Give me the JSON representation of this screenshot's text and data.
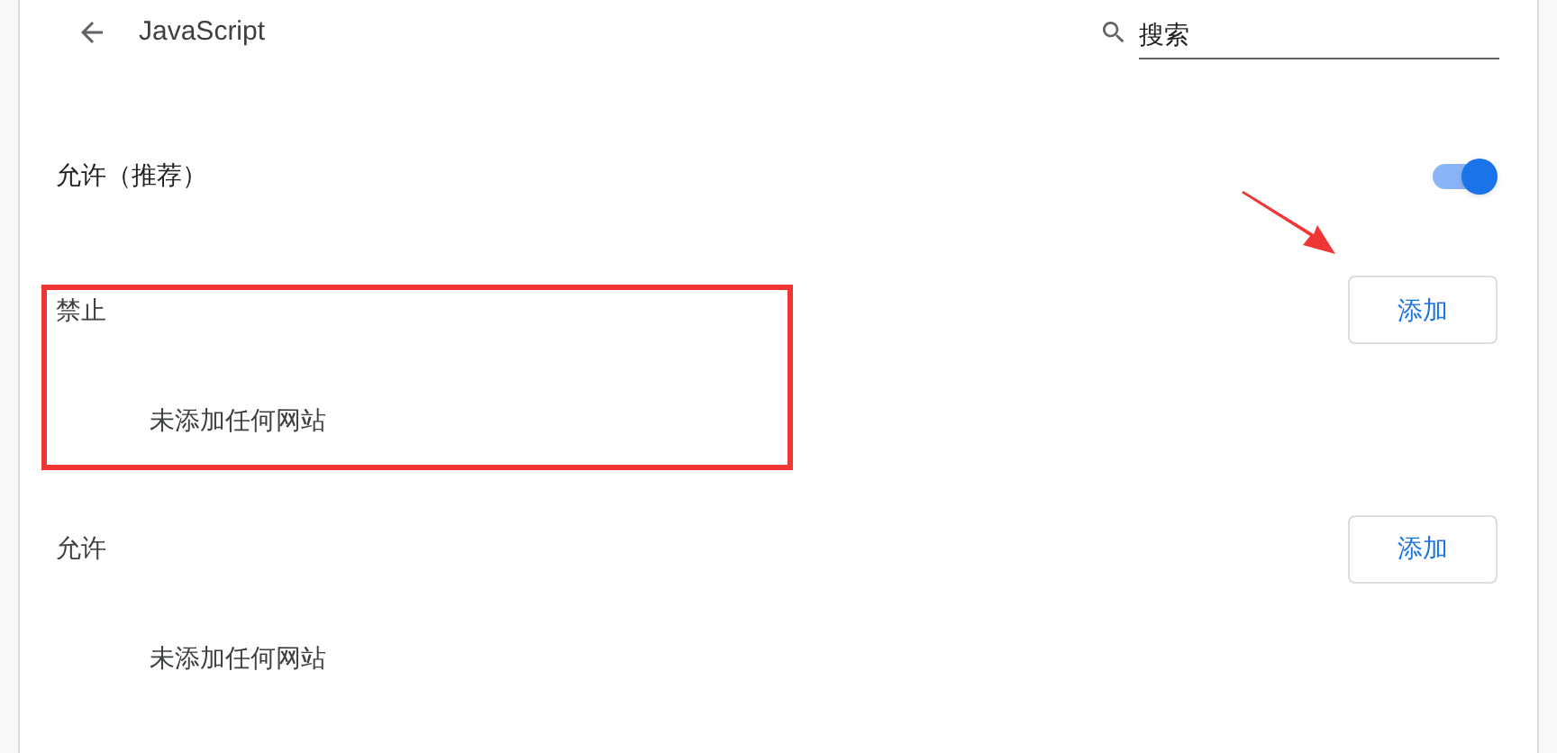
{
  "header": {
    "title": "JavaScript",
    "search": {
      "placeholder": "搜索"
    }
  },
  "default_setting": {
    "label": "允许（推荐）",
    "on": true
  },
  "sections": [
    {
      "title": "禁止",
      "button": "添加",
      "empty_text": "未添加任何网站",
      "highlighted": true
    },
    {
      "title": "允许",
      "button": "添加",
      "empty_text": "未添加任何网站",
      "highlighted": false
    }
  ]
}
